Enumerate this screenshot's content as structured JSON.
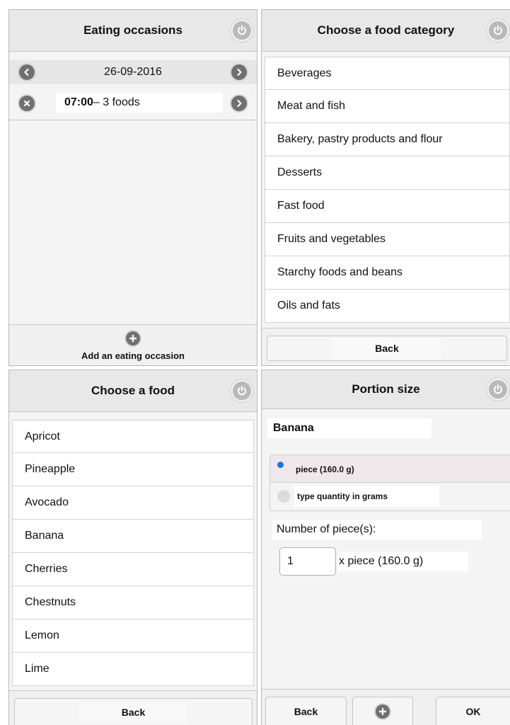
{
  "eating": {
    "title": "Eating occasions",
    "date": "26-09-2016",
    "occasion_time": "07:00",
    "occasion_rest": " – 3 foods",
    "add_label": "Add an eating occasion"
  },
  "category": {
    "title": "Choose a food category",
    "items": [
      "Beverages",
      "Meat and fish",
      "Bakery, pastry products and flour",
      "Desserts",
      "Fast food",
      "Fruits and vegetables",
      "Starchy foods and beans",
      "Oils and fats"
    ],
    "back_label": "Back"
  },
  "food": {
    "title": "Choose a food",
    "items": [
      "Apricot",
      "Pineapple",
      "Avocado",
      "Banana",
      "Cherries",
      "Chestnuts",
      "Lemon",
      "Lime"
    ],
    "back_label": "Back"
  },
  "portion": {
    "title": "Portion size",
    "food_name": "Banana",
    "options": [
      {
        "label": "piece (160.0 g)",
        "selected": true
      },
      {
        "label": "type quantity in grams",
        "selected": false
      }
    ],
    "count_label": "Number of piece(s):",
    "count_value": "1",
    "unit_label": "x piece (160.0 g)",
    "back_label": "Back",
    "ok_label": "OK"
  },
  "colors": {
    "accent": "#1a73e8",
    "icon_dark": "#707070",
    "header_bg": "#e8e8e8"
  },
  "icons": [
    "power-icon",
    "chevron-left-icon",
    "chevron-right-icon",
    "close-icon",
    "plus-icon"
  ]
}
